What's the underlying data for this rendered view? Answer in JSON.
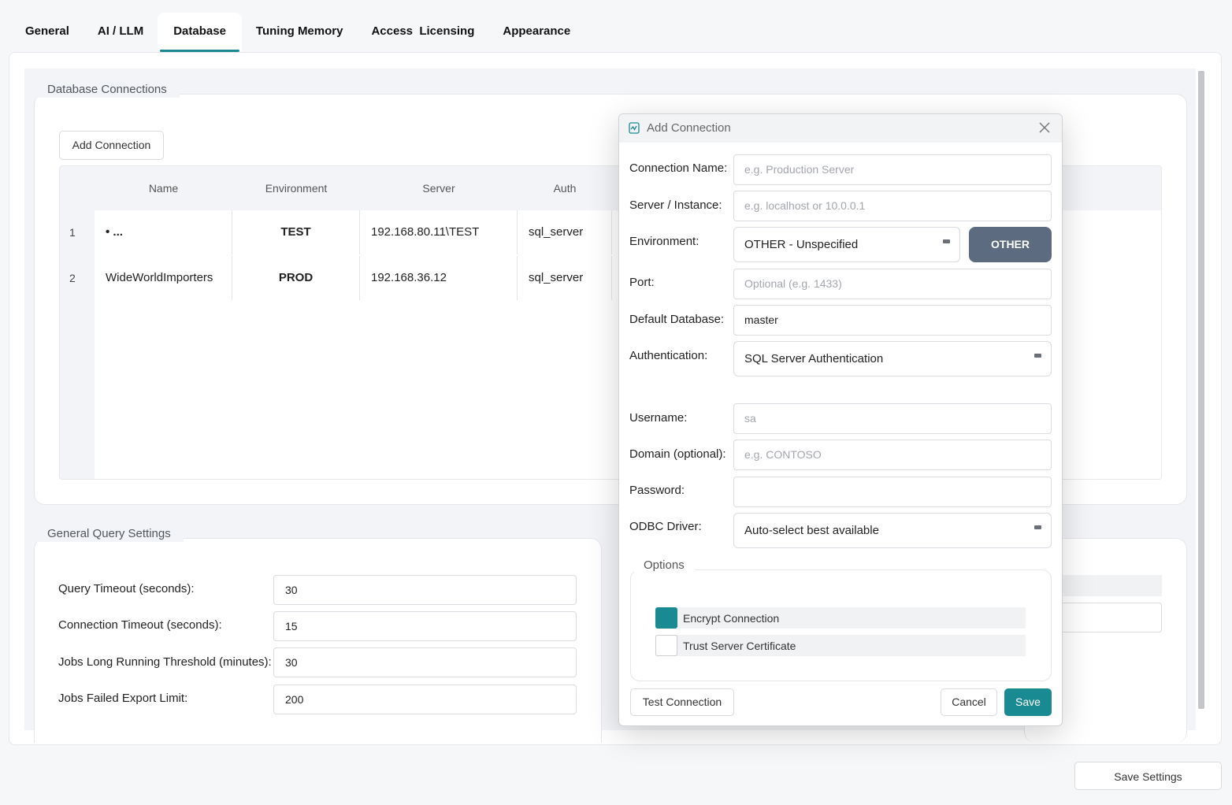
{
  "tabs": [
    {
      "label": "General"
    },
    {
      "label": "AI / LLM"
    },
    {
      "label": "Database"
    },
    {
      "label": "Tuning Memory"
    },
    {
      "label": "Access  Licensing"
    },
    {
      "label": "Appearance"
    }
  ],
  "active_tab": "Database",
  "db_connections": {
    "title": "Database Connections",
    "add_button": "Add Connection",
    "columns": [
      "Name",
      "Environment",
      "Server",
      "Auth"
    ],
    "rows": [
      {
        "num": "1",
        "name": "• ...",
        "environment": "TEST",
        "server": "192.168.80.11\\TEST",
        "auth": "sql_server"
      },
      {
        "num": "2",
        "name": "WideWorldImporters",
        "environment": "PROD",
        "server": "192.168.36.12",
        "auth": "sql_server"
      }
    ]
  },
  "general_query": {
    "title": "General Query Settings",
    "fields": [
      {
        "label": "Query Timeout (seconds):",
        "value": "30"
      },
      {
        "label": "Connection Timeout (seconds):",
        "value": "15"
      },
      {
        "label": "Jobs Long Running Threshold (minutes):",
        "value": "30"
      },
      {
        "label": "Jobs Failed Export Limit:",
        "value": "200"
      }
    ]
  },
  "dialog": {
    "title": "Add Connection",
    "connection_name": {
      "label": "Connection Name:",
      "placeholder": "e.g. Production Server"
    },
    "server": {
      "label": "Server / Instance:",
      "placeholder": "e.g. localhost or 10.0.0.1"
    },
    "environment": {
      "label": "Environment:",
      "value": "OTHER - Unspecified",
      "badge": "OTHER"
    },
    "port": {
      "label": "Port:",
      "placeholder": "Optional (e.g. 1433)"
    },
    "default_db": {
      "label": "Default Database:",
      "value": "master"
    },
    "auth": {
      "label": "Authentication:",
      "value": "SQL Server Authentication"
    },
    "username": {
      "label": "Username:",
      "placeholder": "sa"
    },
    "domain": {
      "label": "Domain (optional):",
      "placeholder": "e.g. CONTOSO"
    },
    "password": {
      "label": "Password:",
      "value": ""
    },
    "odbc": {
      "label": "ODBC Driver:",
      "value": "Auto-select best available"
    },
    "options": {
      "title": "Options",
      "encrypt": {
        "label": "Encrypt Connection",
        "checked": true
      },
      "trust": {
        "label": "Trust Server Certificate",
        "checked": false
      }
    },
    "test_button": "Test Connection",
    "cancel_button": "Cancel",
    "save_button": "Save"
  },
  "save_settings_button": "Save Settings",
  "colors": {
    "accent": "#1a8a92",
    "badge": "#5d6b80"
  }
}
